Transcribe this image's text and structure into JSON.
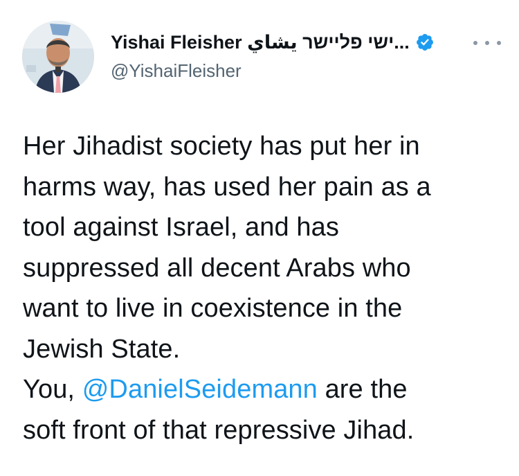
{
  "author": {
    "display_name": "Yishai Fleisher ישי פליישר يشاي...",
    "handle": "@YishaiFleisher",
    "verified": true,
    "avatar_icon": "profile-photo"
  },
  "icons": {
    "verified": "verified-badge-icon",
    "more": "more-options-icon"
  },
  "tweet": {
    "lines": [
      "Her Jihadist society has put her in",
      "harms way, has used her pain as a",
      "tool against Israel, and has",
      "suppressed all decent Arabs who",
      "want to live in coexistence in the",
      "Jewish State."
    ],
    "reply_prefix": "You, ",
    "mention": "@DanielSeidemann",
    "reply_suffix": " are the",
    "last_line": "soft front of that repressive Jihad."
  },
  "colors": {
    "link": "#1d9bf0",
    "text": "#0f1419",
    "secondary": "#536471",
    "verified": "#1d9bf0"
  }
}
